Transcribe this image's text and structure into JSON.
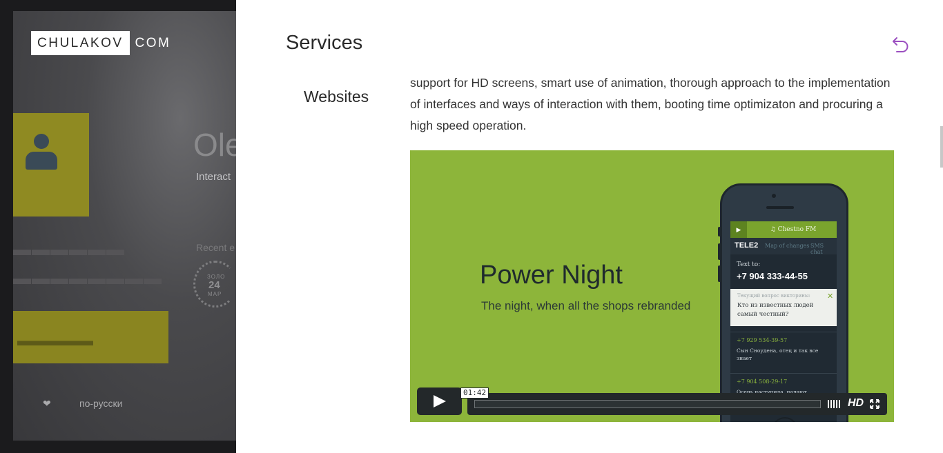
{
  "background_page": {
    "logo": {
      "boxed": "CHULAKOV",
      "rest": "COM"
    },
    "name_fragment": "Ole",
    "role_fragment": "Interact",
    "recent_label": "Recent e",
    "award": {
      "top": "ЗОЛО",
      "number": "24",
      "bottom": "МАР"
    },
    "language_link": "по-русски",
    "heart_icon": "heart-icon"
  },
  "panel": {
    "title": "Services",
    "back_icon": "undo-arrow-icon",
    "section_label": "Websites",
    "body_text": "support for HD screens, smart use of animation, thorough approach to the implementation of interfaces and ways of interaction with them, booting time optimizaton and procuring a high speed operation."
  },
  "video": {
    "title": "Power Night",
    "subtitle": "The night, when all the shops rebranded",
    "time": "01:42",
    "progress": 0.0,
    "hd_label": "HD",
    "accent_color": "#8db53a",
    "phone_screen": {
      "track": "♫ Chestno FM",
      "brand": "TELE2",
      "tab_map": "Map of changes",
      "tab_sms": "SMS chat",
      "text_to": "Text to:",
      "number": "+7 904 333-44-55",
      "quiz_label": "Текущий вопрос викторины:",
      "quiz_question": "Кто из известных людей самый честный?",
      "messages": [
        {
          "number": "+7 929 534-39-57",
          "text": "Сын Сноудена, отец и так все знает"
        },
        {
          "number": "+7 904 508-29-17",
          "text": "Осень наступила, падают"
        }
      ]
    }
  }
}
